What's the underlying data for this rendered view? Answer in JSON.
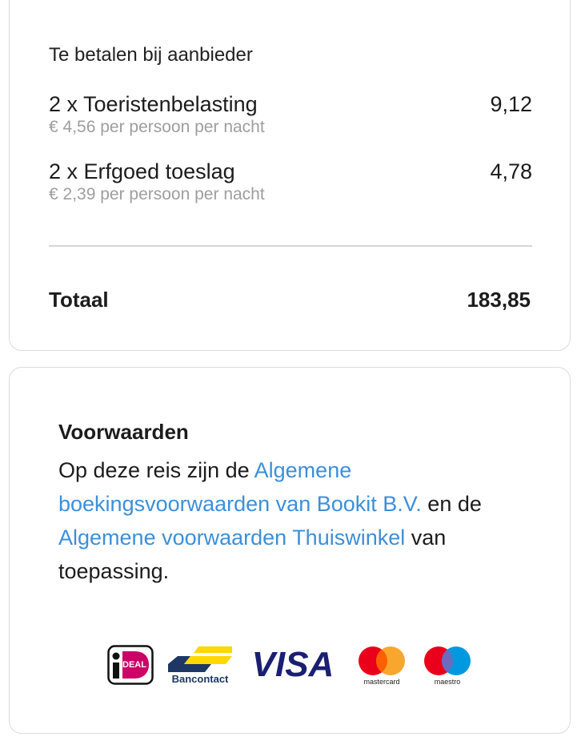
{
  "fees": {
    "section_title": "Te betalen bij aanbieder",
    "items": [
      {
        "name": "2 x Toeristenbelasting",
        "amount": "9,12",
        "detail": "€ 4,56 per persoon per nacht"
      },
      {
        "name": "2 x Erfgoed toeslag",
        "amount": "4,78",
        "detail": "€ 2,39 per persoon per nacht"
      }
    ]
  },
  "total": {
    "label": "Totaal",
    "value": "183,85"
  },
  "terms": {
    "title": "Voorwaarden",
    "text_1": "Op deze reis zijn de ",
    "link_1": "Algemene boekingsvoorwaarden van Bookit B.V.",
    "text_2": " en de ",
    "link_2": "Algemene voorwaarden Thuiswinkel",
    "text_3": " van toepassing."
  },
  "payment_methods": {
    "ideal_text": "DEAL",
    "bancontact_text": "Bancontact",
    "visa_text": "VISA",
    "mastercard_text": "mastercard",
    "maestro_text": "maestro"
  },
  "colors": {
    "link": "#3d8fd9",
    "muted_text": "#9e9e9e",
    "border": "#dcdcdc"
  }
}
